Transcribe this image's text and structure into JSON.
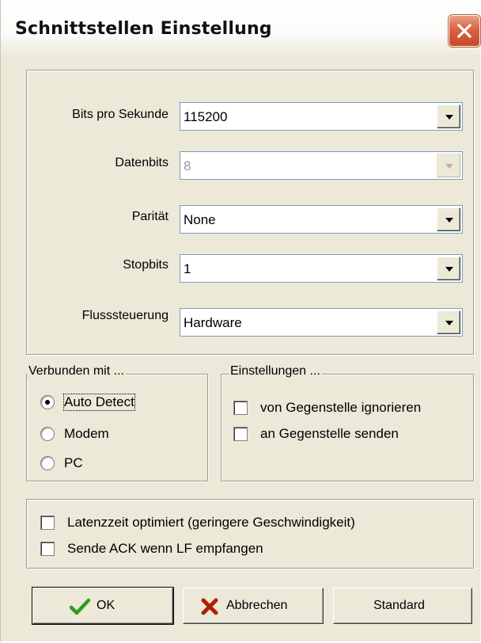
{
  "window": {
    "title": "Schnittstellen Einstellung",
    "close_icon": "close-icon"
  },
  "settings": [
    {
      "label": "Bits pro Sekunde",
      "value": "115200",
      "enabled": true
    },
    {
      "label": "Datenbits",
      "value": "8",
      "enabled": false
    },
    {
      "label": "Parität",
      "value": "None",
      "enabled": true
    },
    {
      "label": "Stopbits",
      "value": "1",
      "enabled": true
    },
    {
      "label": "Flusssteuerung",
      "value": "Hardware",
      "enabled": true
    }
  ],
  "connected": {
    "title": "Verbunden mit ...",
    "options": [
      "Auto Detect",
      "Modem",
      "PC"
    ],
    "selected": "Auto Detect"
  },
  "einstellungen": {
    "title": "Einstellungen ...",
    "options": [
      "von Gegenstelle ignorieren",
      "an Gegenstelle senden"
    ]
  },
  "extra": {
    "options": [
      "Latenzzeit optimiert (geringere Geschwindigkeit)",
      "Sende ACK wenn LF empfangen"
    ]
  },
  "buttons": {
    "ok": "OK",
    "cancel": "Abbrechen",
    "standard": "Standard"
  },
  "colors": {
    "ok_check": "#2e9a1e",
    "cancel_x": "#b31d08",
    "close_bg": "#d9623f"
  }
}
